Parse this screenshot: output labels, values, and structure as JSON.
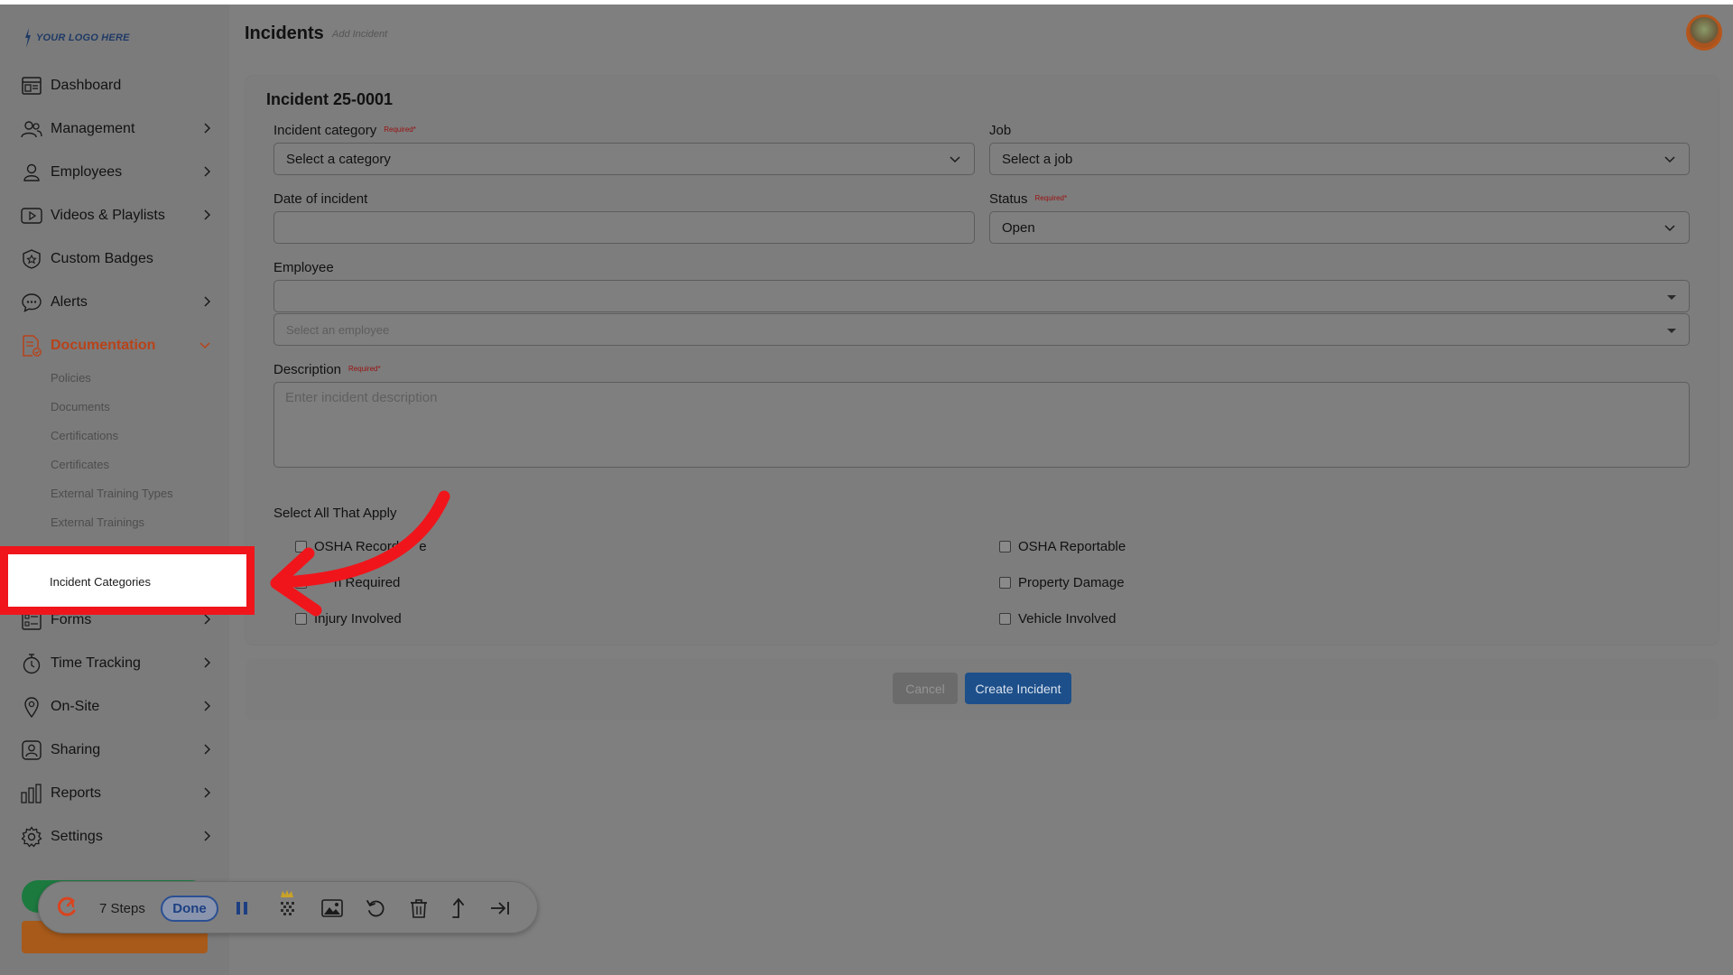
{
  "app": {
    "logo_text": "YOUR LOGO HERE",
    "page_title": "Incidents",
    "page_subtitle": "Add Incident"
  },
  "sidebar": {
    "items": [
      {
        "label": "Dashboard",
        "icon": "dashboard-icon",
        "has_chevron": false
      },
      {
        "label": "Management",
        "icon": "management-icon",
        "has_chevron": true
      },
      {
        "label": "Employees",
        "icon": "employee-icon",
        "has_chevron": true
      },
      {
        "label": "Videos & Playlists",
        "icon": "video-icon",
        "has_chevron": true
      },
      {
        "label": "Custom Badges",
        "icon": "badge-icon",
        "has_chevron": false
      },
      {
        "label": "Alerts",
        "icon": "alerts-icon",
        "has_chevron": true
      },
      {
        "label": "Documentation",
        "icon": "documentation-icon",
        "has_chevron": true,
        "active": true
      },
      {
        "label": "Forms",
        "icon": "forms-icon",
        "has_chevron": true
      },
      {
        "label": "Time Tracking",
        "icon": "stopwatch-icon",
        "has_chevron": true
      },
      {
        "label": "On-Site",
        "icon": "location-pin-icon",
        "has_chevron": true
      },
      {
        "label": "Sharing",
        "icon": "sharing-icon",
        "has_chevron": true
      },
      {
        "label": "Reports",
        "icon": "reports-icon",
        "has_chevron": true
      },
      {
        "label": "Settings",
        "icon": "gear-icon",
        "has_chevron": true
      }
    ],
    "documentation_subitems": [
      "Policies",
      "Documents",
      "Certifications",
      "Certificates",
      "External Training Types",
      "External Trainings"
    ],
    "highlighted_subitem": "Incident Categories"
  },
  "form": {
    "title": "Incident 25-0001",
    "required_marker": "Required*",
    "incident_category": {
      "label": "Incident category",
      "value": "Select a category"
    },
    "job": {
      "label": "Job",
      "value": "Select a job"
    },
    "date": {
      "label": "Date of incident",
      "value": ""
    },
    "status": {
      "label": "Status",
      "value": "Open"
    },
    "employee": {
      "label": "Employee",
      "value": "",
      "placeholder": "Select an employee"
    },
    "description": {
      "label": "Description",
      "placeholder": "Enter incident description"
    },
    "checkboxes_heading": "Select All That Apply",
    "checkboxes": [
      {
        "label": "OSHA Recordable",
        "visible_text": "OSHA Record",
        "visible_text_tail": "e",
        "checked": false
      },
      {
        "label": "OSHA Reportable",
        "checked": false
      },
      {
        "label": "Claim Required",
        "visible_text": "n Required",
        "checked": false
      },
      {
        "label": "Property Damage",
        "checked": false
      },
      {
        "label": "Injury Involved",
        "checked": false
      },
      {
        "label": "Vehicle Involved",
        "checked": false
      }
    ]
  },
  "actions": {
    "cancel_label": "Cancel",
    "create_label": "Create Incident"
  },
  "recorder": {
    "steps_label": "7 Steps",
    "done_label": "Done",
    "tools": [
      "pause-icon",
      "blur-icon",
      "image-icon",
      "undo-icon",
      "trash-icon",
      "export-icon",
      "skip-to-end-icon"
    ]
  },
  "colors": {
    "accent_active": "#b8431a",
    "primary_button": "#1d4f8a",
    "highlight_border": "#f0151b",
    "required_text": "#9a1010"
  }
}
